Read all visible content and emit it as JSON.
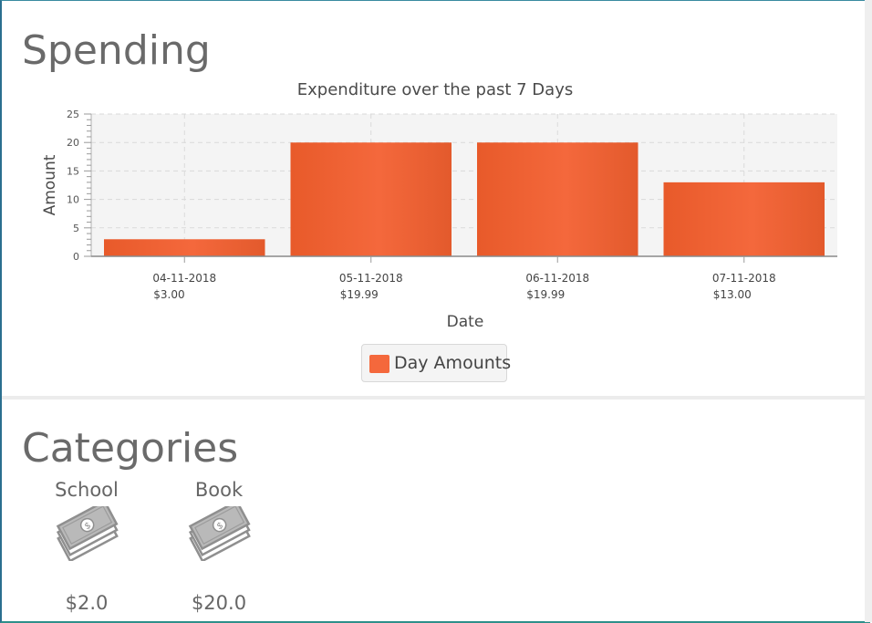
{
  "spending": {
    "title": "Spending"
  },
  "chart_data": {
    "type": "bar",
    "title": "Expenditure over the past 7 Days",
    "xlabel": "Date",
    "ylabel": "Amount",
    "ylim": [
      0,
      25
    ],
    "yticks": [
      0,
      5,
      10,
      15,
      20,
      25
    ],
    "categories": [
      "04-11-2018",
      "05-11-2018",
      "06-11-2018",
      "07-11-2018"
    ],
    "sublabels": [
      "$3.00",
      "$19.99",
      "$19.99",
      "$13.00"
    ],
    "series": [
      {
        "name": "Day Amounts",
        "values": [
          3.0,
          19.99,
          19.99,
          13.0
        ]
      }
    ],
    "grid": true,
    "legend_position": "bottom",
    "bar_color": "#f4683c"
  },
  "categories": {
    "title": "Categories",
    "items": [
      {
        "name": "School",
        "amount": "$2.0",
        "icon": "money-icon"
      },
      {
        "name": "Book",
        "amount": "$20.0",
        "icon": "money-icon"
      }
    ]
  }
}
